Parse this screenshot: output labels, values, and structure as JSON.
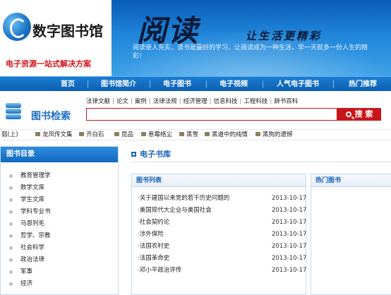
{
  "header": {
    "logo_text": "数字图书馆",
    "slogan": "电子资源一站式解决方案",
    "banner_title": "阅读",
    "banner_subtitle": "让生活更精彩",
    "banner_text": "阅读使人充实，读书是最好的学习，让阅读成为一种生活，早一天就多一份人生的精彩！"
  },
  "nav": {
    "items": [
      "首页",
      "图书馆简介",
      "电子图书",
      "电子视频",
      "人气电子图书",
      "热门推荐"
    ]
  },
  "search": {
    "title": "图书检索",
    "categories": [
      "法律文献",
      "论文",
      "案例",
      "法律法规",
      "经济管理",
      "信息科技",
      "工程科技",
      "辞书百科"
    ],
    "placeholder": "",
    "button_label": "搜 索"
  },
  "ticker": {
    "lead": "弱(上)",
    "items": [
      "龙凤传文集",
      "齐白石",
      "昆品",
      "惹霉络尘",
      "黑雪",
      "黑道中的纯情",
      "黑狗的遗憾"
    ]
  },
  "sidebar": {
    "title": "图书目录",
    "items": [
      "教育管理学",
      "数学文库",
      "学生文库",
      "学科专业书",
      "马恩列毛",
      "哲学、宗教",
      "社会科学",
      "政治法律",
      "军事",
      "经济"
    ]
  },
  "main": {
    "section_title": "电子书库",
    "book_list": {
      "title": "图书列表",
      "books": [
        {
          "title": "·关于建国以来党的若干历史问题的",
          "date": "2013-10-17"
        },
        {
          "title": "·美国现代大企业与美国社会",
          "date": "2013-10-17"
        },
        {
          "title": "·社会契约论",
          "date": "2013-10-17"
        },
        {
          "title": "·涉外保险",
          "date": "2013-10-17"
        },
        {
          "title": "·法国农村史",
          "date": "2013-10-17"
        },
        {
          "title": "·法国革命史",
          "date": "2013-10-17"
        },
        {
          "title": "·邓小平政治评传",
          "date": "2013-10-17"
        }
      ]
    },
    "hot_books": {
      "title": "热门图书"
    }
  },
  "colors": {
    "brand_blue": "#1a62b5",
    "nav_blue": "#0c5fb1",
    "accent_red": "#c9151a"
  }
}
